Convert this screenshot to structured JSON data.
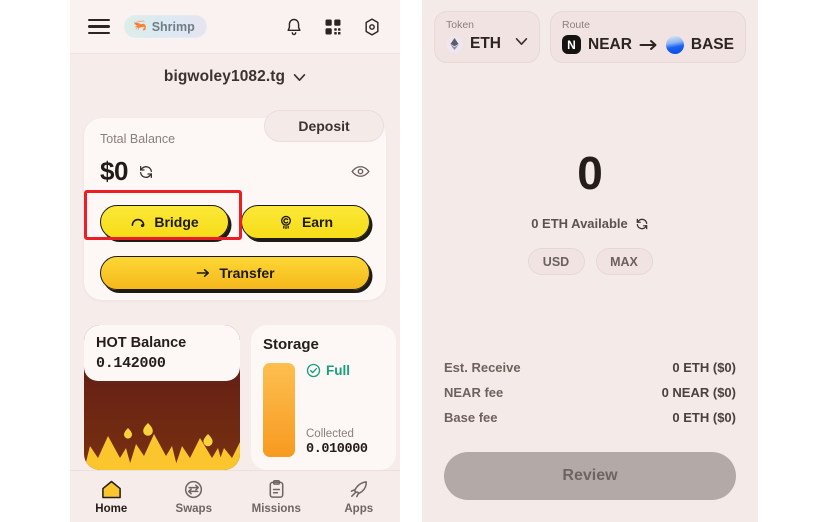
{
  "wallet": {
    "header": {
      "menu_icon": "hamburger-icon",
      "badge_label": "Shrimp",
      "badge_icon": "shrimp-icon",
      "notification_icon": "bell-icon",
      "qr_icon": "qr-code-icon",
      "settings_icon": "gear-icon"
    },
    "account": {
      "name": "bigwoley1082.tg",
      "chevron_icon": "chevron-down-icon"
    },
    "balance": {
      "label": "Total Balance",
      "amount": "$0",
      "refresh_icon": "refresh-icon",
      "eye_icon": "eye-icon",
      "deposit_label": "Deposit"
    },
    "actions": {
      "bridge_label": "Bridge",
      "bridge_icon": "bridge-arc-icon",
      "earn_label": "Earn",
      "earn_icon": "coin-icon",
      "transfer_label": "Transfer",
      "transfer_icon": "arrow-right-icon",
      "highlight_color": "#ec1d24"
    },
    "hot_card": {
      "title": "HOT Balance",
      "value": "0.142000"
    },
    "storage_card": {
      "title": "Storage",
      "status": "Full",
      "status_icon": "check-circle-icon",
      "status_color": "#18a07d",
      "collected_label": "Collected",
      "collected_value": "0.010000"
    },
    "nav": [
      {
        "label": "Home",
        "icon": "home-icon",
        "active": true
      },
      {
        "label": "Swaps",
        "icon": "swap-icon",
        "active": false
      },
      {
        "label": "Missions",
        "icon": "clipboard-icon",
        "active": false
      },
      {
        "label": "Apps",
        "icon": "rocket-icon",
        "active": false
      }
    ]
  },
  "bridge": {
    "token_selector": {
      "label": "Token",
      "value": "ETH",
      "token_icon": "ethereum-icon",
      "chevron_icon": "chevron-down-icon"
    },
    "route_selector": {
      "label": "Route",
      "from": "NEAR",
      "from_icon": "near-icon",
      "arrow_icon": "arrow-right-icon",
      "to": "BASE",
      "to_icon": "base-icon"
    },
    "amount": {
      "value": "0",
      "available": "0 ETH Available",
      "refresh_icon": "refresh-icon",
      "usd_label": "USD",
      "max_label": "MAX"
    },
    "fees": [
      {
        "key": "Est. Receive",
        "value": "0 ETH ($0)"
      },
      {
        "key": "NEAR fee",
        "value": "0 NEAR ($0)"
      },
      {
        "key": "Base fee",
        "value": "0 ETH ($0)"
      }
    ],
    "review_label": "Review"
  }
}
